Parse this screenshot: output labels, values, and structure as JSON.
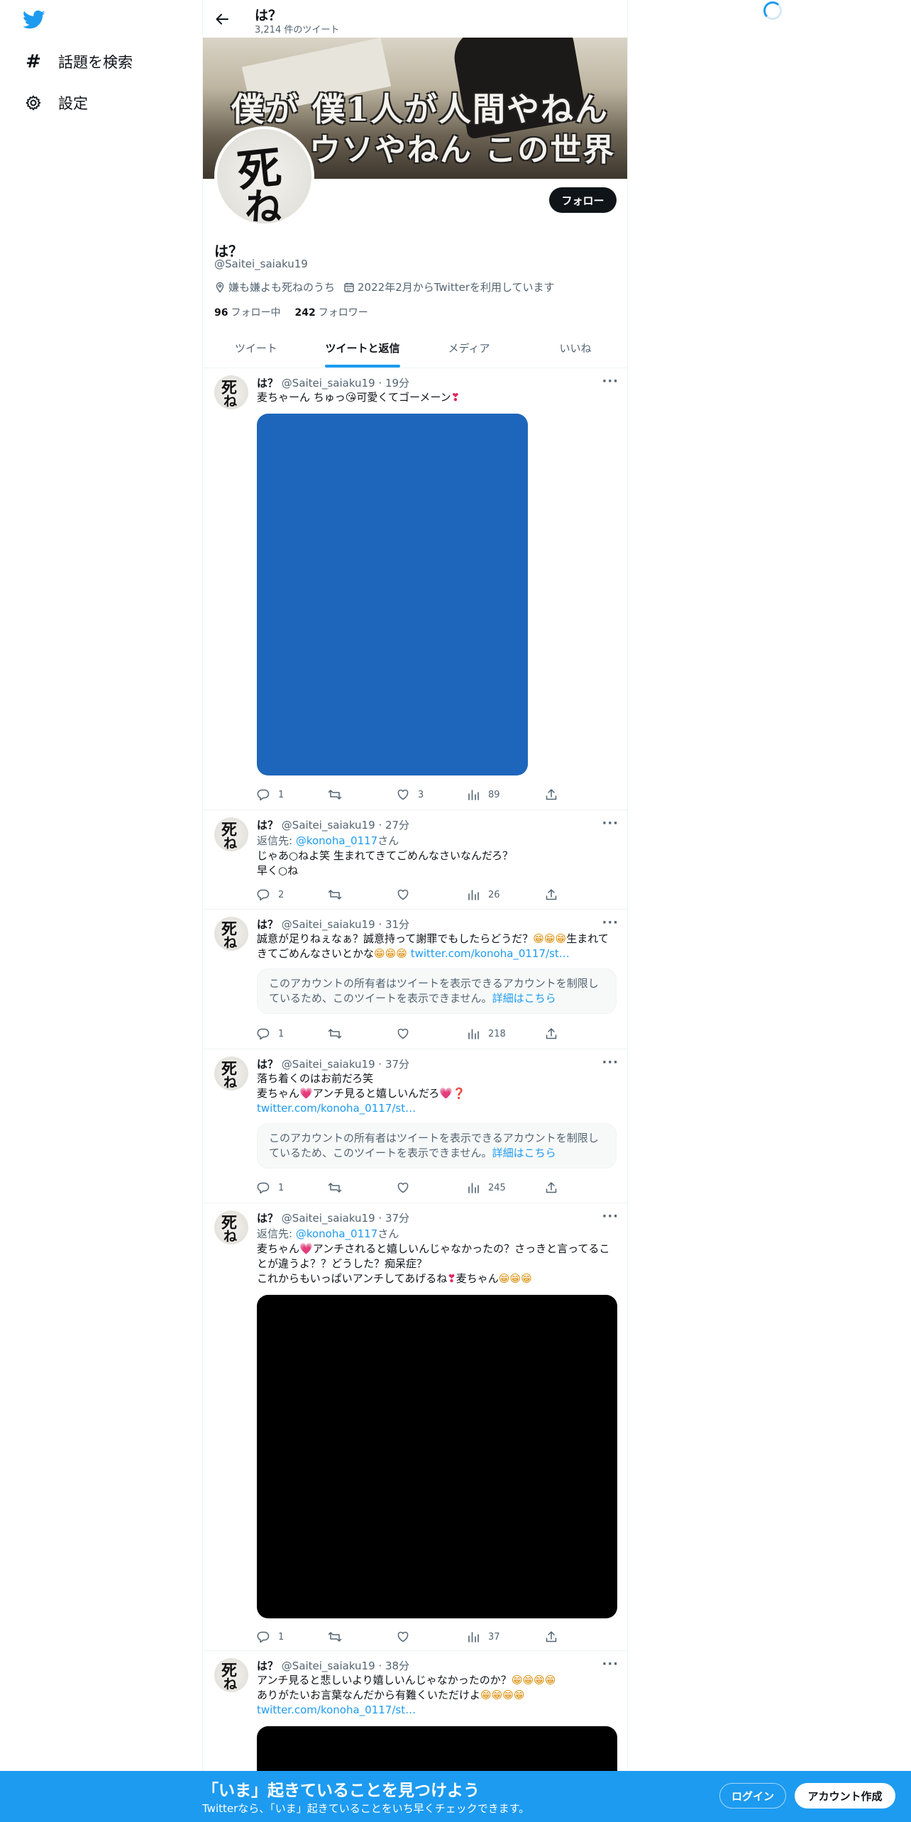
{
  "nav": {
    "explore_label": "話題を検索",
    "settings_label": "設定"
  },
  "header": {
    "title": "は？",
    "tweet_count": "3,214 件のツイート"
  },
  "banner": {
    "caption_line1": "僕が 僕1人が人間やねん",
    "caption_line2": "ウソやねん この世界"
  },
  "avatar": {
    "char1": "死",
    "char2": "ね"
  },
  "profile": {
    "follow_label": "フォロー",
    "name": "は？",
    "handle": "@Saitei_saiaku19",
    "location": "嫌も嫌よも死ねのうち",
    "joined": "2022年2月からTwitterを利用しています",
    "following_count": "96",
    "following_label": "フォロー中",
    "followers_count": "242",
    "followers_label": "フォロワー"
  },
  "tabs": [
    {
      "label": "ツイート"
    },
    {
      "label": "ツイートと返信"
    },
    {
      "label": "メディア"
    },
    {
      "label": "いいね"
    }
  ],
  "tweets": [
    {
      "name": "は？",
      "meta": "@Saitei_saiaku19 · 19分",
      "text_a": "麦ちゃーん ちゅっ",
      "emoji_a": "😘",
      "text_b": "可愛くてゴーメーン",
      "emoji_b": "❣",
      "media_color": "#1e66bb",
      "replies": "1",
      "likes": "3",
      "views": "89"
    },
    {
      "name": "は？",
      "meta": "@Saitei_saiaku19 · 27分",
      "reply_prefix": "返信先: ",
      "reply_to": "@konoha_0117",
      "reply_suffix": "さん",
      "text": "じゃあ○ねよ笑 生まれてきてごめんなさいなんだろ？\n早く○ね",
      "replies": "2",
      "likes": "",
      "views": "26"
    },
    {
      "name": "は？",
      "meta": "@Saitei_saiaku19 · 31分",
      "text_a": "誠意が足りねぇなぁ？誠意持って謝罪でもしたらどうだ？",
      "emoji_a": "😁😁😁",
      "text_b": "生まれてきてごめんなさいとかな",
      "emoji_b": "😁😁😁",
      "link": "twitter.com/konoha_0117/st…",
      "notice": "このアカウントの所有者はツイートを表示できるアカウントを制限しているため、このツイートを表示できません。",
      "notice_link": "詳細はこちら",
      "replies": "1",
      "likes": "",
      "views": "218"
    },
    {
      "name": "は？",
      "meta": "@Saitei_saiaku19 · 37分",
      "text_line1": "落ち着くのはお前だろ笑",
      "text_a": "麦ちゃん",
      "emoji_a": "💗",
      "text_b": "アンチ見ると嬉しいんだろ",
      "emoji_b": "💗",
      "emoji_c": "❓",
      "link": "twitter.com/konoha_0117/st…",
      "notice": "このアカウントの所有者はツイートを表示できるアカウントを制限しているため、このツイートを表示できません。",
      "notice_link": "詳細はこちら",
      "replies": "1",
      "likes": "",
      "views": "245"
    },
    {
      "name": "は？",
      "meta": "@Saitei_saiaku19 · 37分",
      "reply_prefix": "返信先: ",
      "reply_to": "@konoha_0117",
      "reply_suffix": "さん",
      "text_a": "麦ちゃん",
      "emoji_a": "💗",
      "text_b": "アンチされると嬉しいんじゃなかったの？さっきと言ってることが違うよ？？どうした？痴呆症？\nこれからもいっぱいアンチしてあげるね",
      "emoji_b": "❣",
      "text_c": "麦ちゃん",
      "emoji_c": "😁😁😁",
      "media_color": "#000000",
      "replies": "1",
      "likes": "",
      "views": "37"
    },
    {
      "name": "は？",
      "meta": "@Saitei_saiaku19 · 38分",
      "text_a": "アンチ見ると悲しいより嬉しいんじゃなかったのか？",
      "emoji_a": "😁😁😁😁",
      "text_b": "ありがたいお言葉なんだから有難くいただけよ",
      "emoji_b": "😁😁😁😁",
      "link": "twitter.com/konoha_0117/st…",
      "media_color": "#000000"
    }
  ],
  "bottom_bar": {
    "title": "「いま」起きていることを見つけよう",
    "subtitle": "Twitterなら、「いま」起きていることをいち早くチェックできます。",
    "login_label": "ログイン",
    "signup_label": "アカウント作成"
  },
  "colors": {
    "accent": "#1d9bf0",
    "text": "#0f1419",
    "muted": "#536471",
    "button_dark": "#0f1419"
  }
}
